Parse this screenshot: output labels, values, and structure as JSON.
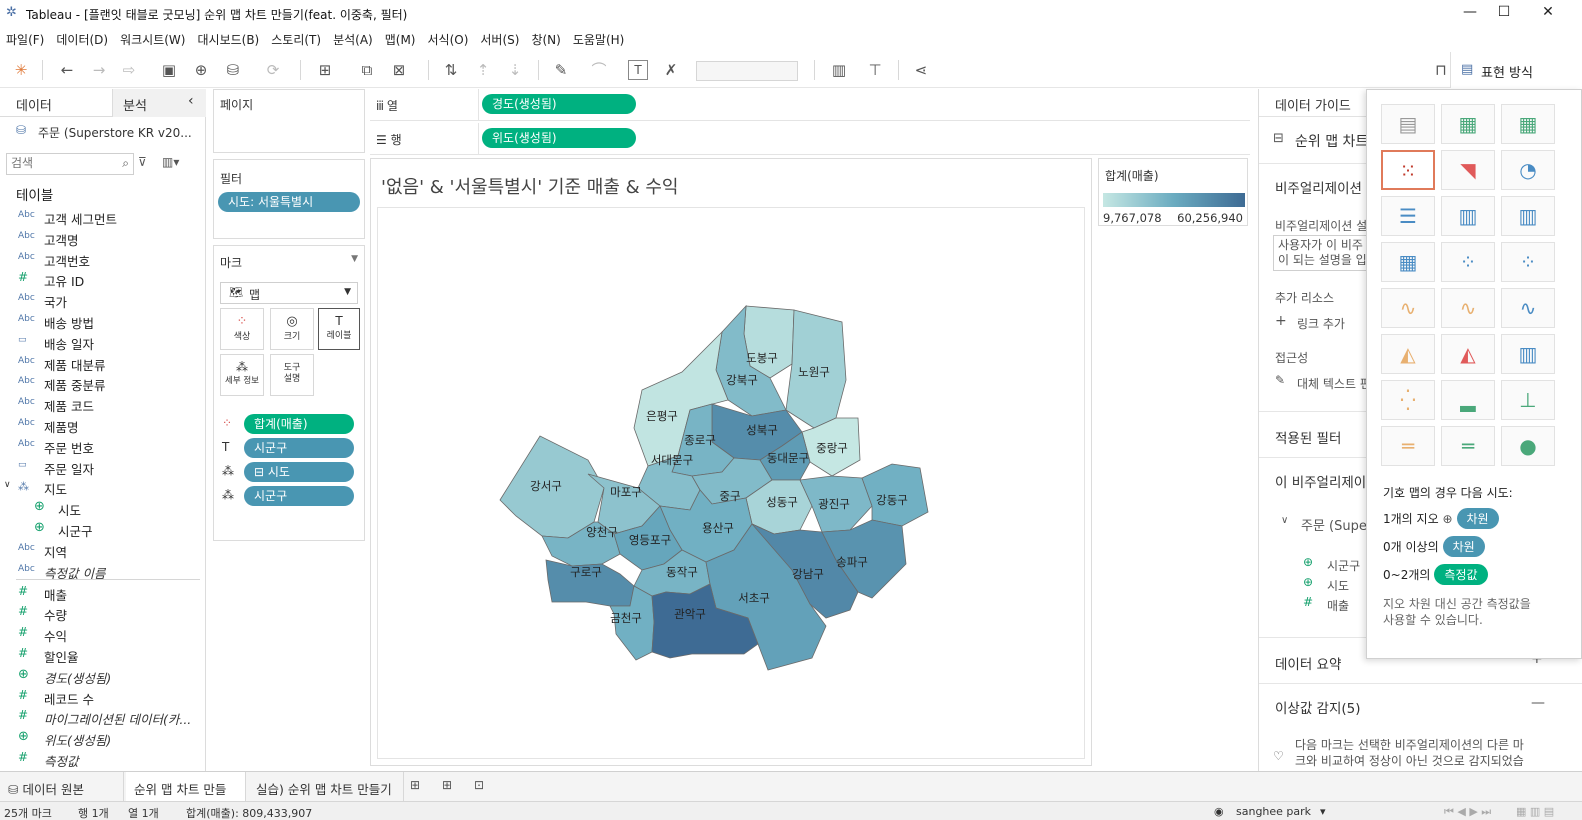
{
  "window": {
    "title": "Tableau - [플랜잇 태블로 굿모닝] 순위 맵 차트 만들기(feat. 이중축, 필터)"
  },
  "menu": [
    "파일(F)",
    "데이터(D)",
    "워크시트(W)",
    "대시보드(B)",
    "스토리(T)",
    "분석(A)",
    "맵(M)",
    "서식(O)",
    "서버(S)",
    "창(N)",
    "도움말(H)"
  ],
  "toolbar": {
    "show_me": "표현 방식"
  },
  "left": {
    "tab_data": "데이터",
    "tab_analysis": "분석",
    "datasource": "주문 (Superstore KR v20...",
    "search_placeholder": "검색",
    "tables_header": "테이블",
    "fields": [
      {
        "type": "Abc",
        "name": "고객 세그먼트"
      },
      {
        "type": "Abc",
        "name": "고객명"
      },
      {
        "type": "Abc",
        "name": "고객번호"
      },
      {
        "type": "#",
        "name": "고유 ID"
      },
      {
        "type": "Abc",
        "name": "국가"
      },
      {
        "type": "Abc",
        "name": "배송 방법"
      },
      {
        "type": "date",
        "name": "배송 일자"
      },
      {
        "type": "Abc",
        "name": "제품 대분류"
      },
      {
        "type": "Abc",
        "name": "제품 중분류"
      },
      {
        "type": "Abc",
        "name": "제품 코드"
      },
      {
        "type": "Abc",
        "name": "제품명"
      },
      {
        "type": "Abc",
        "name": "주문 번호"
      },
      {
        "type": "date",
        "name": "주문 일자"
      },
      {
        "type": "hier",
        "name": "지도"
      },
      {
        "type": "geo",
        "name": "시도",
        "indent": true
      },
      {
        "type": "geo",
        "name": "시군구",
        "indent": true
      },
      {
        "type": "Abc",
        "name": "지역"
      },
      {
        "type": "Abc",
        "name": "측정값 이름",
        "italic": true
      },
      {
        "type": "#",
        "name": "매출"
      },
      {
        "type": "#",
        "name": "수량"
      },
      {
        "type": "#",
        "name": "수익"
      },
      {
        "type": "#",
        "name": "할인율"
      },
      {
        "type": "geo",
        "name": "경도(생성됨)",
        "italic": true
      },
      {
        "type": "#",
        "name": "레코드 수"
      },
      {
        "type": "#",
        "name": "마이그레이션된 데이터(카...",
        "italic": true
      },
      {
        "type": "geo",
        "name": "위도(생성됨)",
        "italic": true
      },
      {
        "type": "#",
        "name": "측정값",
        "italic": true
      }
    ]
  },
  "cards": {
    "pages": "페이지",
    "filters": "필터",
    "filter_pill": "시도: 서울특별시",
    "marks": "마크",
    "mark_type": "맵",
    "mark_buttons": [
      "색상",
      "크기",
      "레이블",
      "세부 정보",
      "도구 설명"
    ],
    "mark_pills": [
      {
        "icon": "color",
        "label": "합계(매출)",
        "color": "green"
      },
      {
        "icon": "label",
        "label": "시군구",
        "color": "blue"
      },
      {
        "icon": "detail",
        "label": "⊟ 시도",
        "color": "blue"
      },
      {
        "icon": "detail",
        "label": "시군구",
        "color": "blue"
      }
    ]
  },
  "shelves": {
    "columns_label": "열",
    "rows_label": "행",
    "columns_pill": "경도(생성됨)",
    "rows_pill": "위도(생성됨)"
  },
  "view": {
    "title": "'없음' & '서울특별시' 기준 매출 & 수익",
    "districts": [
      {
        "name": "도봉구",
        "value": 15
      },
      {
        "name": "노원구",
        "value": 25
      },
      {
        "name": "강북구",
        "value": 40
      },
      {
        "name": "은평구",
        "value": 10
      },
      {
        "name": "성북구",
        "value": 72
      },
      {
        "name": "종로구",
        "value": 45
      },
      {
        "name": "중랑구",
        "value": 8
      },
      {
        "name": "서대문구",
        "value": 38
      },
      {
        "name": "동대문구",
        "value": 62
      },
      {
        "name": "강서구",
        "value": 30
      },
      {
        "name": "마포구",
        "value": 35
      },
      {
        "name": "중구",
        "value": 40
      },
      {
        "name": "성동구",
        "value": 22
      },
      {
        "name": "광진구",
        "value": 42
      },
      {
        "name": "강동구",
        "value": 48
      },
      {
        "name": "용산구",
        "value": 48
      },
      {
        "name": "양천구",
        "value": 45
      },
      {
        "name": "영등포구",
        "value": 55
      },
      {
        "name": "구로구",
        "value": 72
      },
      {
        "name": "동작구",
        "value": 45
      },
      {
        "name": "서초구",
        "value": 58
      },
      {
        "name": "강남구",
        "value": 75
      },
      {
        "name": "송파구",
        "value": 68
      },
      {
        "name": "금천구",
        "value": 48
      },
      {
        "name": "관악구",
        "value": 95
      }
    ]
  },
  "legend": {
    "title": "합계(매출)",
    "min": "9,767,078",
    "max": "60,256,940",
    "colors": [
      "#c5e7e3",
      "#6aabc0",
      "#3e6b94"
    ]
  },
  "guide": {
    "header": "데이터 가이드",
    "sheet": "순위 맵 차트",
    "viz_desc": "비주얼리제이션 ",
    "viz_desc2": "비주얼리제이션 설",
    "desc_box": "사용자가 이 비주",
    "desc_box2": "이 되는 설명을 입",
    "resources": "추가 리소스",
    "add_link": "링크 추가",
    "accessibility": "접근성",
    "alt_text": "대체 텍스트 편",
    "applied_filters": "적용된 필터",
    "this_viz": "이 비주얼리제이",
    "source": "주문 (Supe",
    "src_fields": [
      "시군구",
      "시도",
      "매출"
    ],
    "data_summary": "데이터 요약",
    "outliers": "이상값 감지(5)",
    "outlier_desc": "다음 마크는 선택한 비주얼리제이션의 다른 마",
    "outlier_desc2": "크와 비교하여 정상이 아닌 것으로 감지되었습"
  },
  "showme": {
    "hint_title": "기호 맵의 경우 다음 시도:",
    "line1_pre": "1개의 지오",
    "line1_chip": "차원",
    "line2_pre": "0개 이상의",
    "line2_chip": "차원",
    "line3_pre": "0~2개의",
    "line3_chip": "측정값",
    "note": "지오 차원 대신 공간 측정값을",
    "note2": "사용할 수 있습니다."
  },
  "bottom": {
    "tabs": [
      "데이터 원본",
      "순위 맵 차트 만들기",
      "실습) 순위 맵 차트 만들기"
    ],
    "status_marks": "25개 마크",
    "status_rows": "행 1개",
    "status_cols": "열 1개",
    "status_sum": "합계(매출): 809,433,907",
    "user": "sanghee park"
  }
}
